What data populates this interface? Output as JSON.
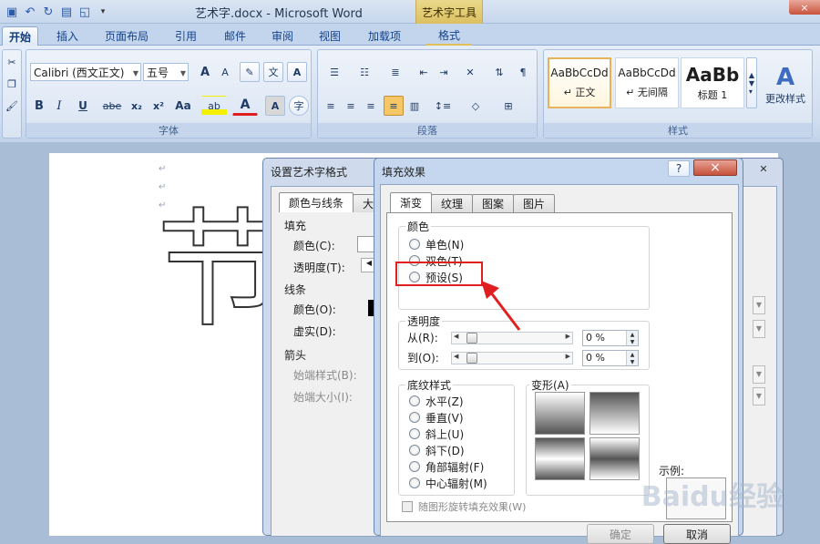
{
  "window": {
    "title": "艺术字.docx - Microsoft Word",
    "contextual_tab_group": "艺术字工具",
    "close_icon": "×"
  },
  "ribbon_tabs": [
    "开始",
    "插入",
    "页面布局",
    "引用",
    "邮件",
    "审阅",
    "视图",
    "加载项",
    "格式"
  ],
  "ribbon": {
    "font_name": "Calibri (西文正文)",
    "font_size": "五号",
    "group_font": "字体",
    "group_paragraph": "段落",
    "group_styles": "样式",
    "styles": [
      {
        "preview": "AaBbCcDd",
        "name": "↵ 正文"
      },
      {
        "preview": "AaBbCcDd",
        "name": "↵ 无间隔"
      },
      {
        "preview": "AaBb",
        "name": "标题 1"
      }
    ],
    "change_styles": "更改样式",
    "bold": "B",
    "italic": "I",
    "underline": "U",
    "strike": "abe",
    "sub": "x₂",
    "sup": "x²",
    "case": "Aa",
    "highlight": "ab",
    "font_color": "A",
    "char_shade": "A",
    "enclose": "字",
    "grow": "A",
    "shrink": "A",
    "phonetic": "文",
    "border": "A"
  },
  "document": {
    "wordart_text": "节",
    "para_mark": "↵"
  },
  "wordart_dialog": {
    "title": "设置艺术字格式",
    "tabs": [
      "颜色与线条",
      "大"
    ],
    "fill_heading": "填充",
    "color_label": "颜色(C):",
    "transparency_label": "透明度(T):",
    "line_heading": "线条",
    "line_color_label": "颜色(O):",
    "dash_label": "虚实(D):",
    "arrow_heading": "箭头",
    "begin_style_label": "始端样式(B):",
    "begin_size_label": "始端大小(I):"
  },
  "fill_dialog": {
    "title": "填充效果",
    "help": "?",
    "close": "×",
    "tabs": [
      "渐变",
      "纹理",
      "图案",
      "图片"
    ],
    "colors_heading": "颜色",
    "color_options": [
      "单色(N)",
      "双色(T)",
      "预设(S)"
    ],
    "transparency_heading": "透明度",
    "from_label": "从(R):",
    "to_label": "到(O):",
    "from_value": "0 %",
    "to_value": "0 %",
    "shading_heading": "底纹样式",
    "shading_options": [
      "水平(Z)",
      "垂直(V)",
      "斜上(U)",
      "斜下(D)",
      "角部辐射(F)",
      "中心辐射(M)"
    ],
    "variants_heading": "变形(A)",
    "sample_label": "示例:",
    "rotate_checkbox": "随图形旋转填充效果(W)",
    "ok": "确定",
    "cancel": "取消"
  },
  "annotation_color": "#e02020",
  "watermark": "Baidu经验"
}
